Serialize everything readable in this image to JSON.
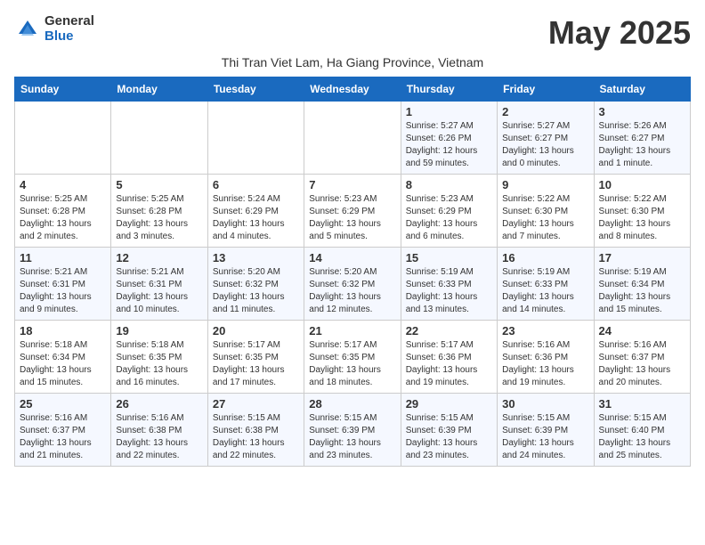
{
  "logo": {
    "general": "General",
    "blue": "Blue"
  },
  "header": {
    "month_title": "May 2025",
    "subtitle": "Thi Tran Viet Lam, Ha Giang Province, Vietnam"
  },
  "weekdays": [
    "Sunday",
    "Monday",
    "Tuesday",
    "Wednesday",
    "Thursday",
    "Friday",
    "Saturday"
  ],
  "weeks": [
    [
      {
        "day": "",
        "info": ""
      },
      {
        "day": "",
        "info": ""
      },
      {
        "day": "",
        "info": ""
      },
      {
        "day": "",
        "info": ""
      },
      {
        "day": "1",
        "info": "Sunrise: 5:27 AM\nSunset: 6:26 PM\nDaylight: 12 hours\nand 59 minutes."
      },
      {
        "day": "2",
        "info": "Sunrise: 5:27 AM\nSunset: 6:27 PM\nDaylight: 13 hours\nand 0 minutes."
      },
      {
        "day": "3",
        "info": "Sunrise: 5:26 AM\nSunset: 6:27 PM\nDaylight: 13 hours\nand 1 minute."
      }
    ],
    [
      {
        "day": "4",
        "info": "Sunrise: 5:25 AM\nSunset: 6:28 PM\nDaylight: 13 hours\nand 2 minutes."
      },
      {
        "day": "5",
        "info": "Sunrise: 5:25 AM\nSunset: 6:28 PM\nDaylight: 13 hours\nand 3 minutes."
      },
      {
        "day": "6",
        "info": "Sunrise: 5:24 AM\nSunset: 6:29 PM\nDaylight: 13 hours\nand 4 minutes."
      },
      {
        "day": "7",
        "info": "Sunrise: 5:23 AM\nSunset: 6:29 PM\nDaylight: 13 hours\nand 5 minutes."
      },
      {
        "day": "8",
        "info": "Sunrise: 5:23 AM\nSunset: 6:29 PM\nDaylight: 13 hours\nand 6 minutes."
      },
      {
        "day": "9",
        "info": "Sunrise: 5:22 AM\nSunset: 6:30 PM\nDaylight: 13 hours\nand 7 minutes."
      },
      {
        "day": "10",
        "info": "Sunrise: 5:22 AM\nSunset: 6:30 PM\nDaylight: 13 hours\nand 8 minutes."
      }
    ],
    [
      {
        "day": "11",
        "info": "Sunrise: 5:21 AM\nSunset: 6:31 PM\nDaylight: 13 hours\nand 9 minutes."
      },
      {
        "day": "12",
        "info": "Sunrise: 5:21 AM\nSunset: 6:31 PM\nDaylight: 13 hours\nand 10 minutes."
      },
      {
        "day": "13",
        "info": "Sunrise: 5:20 AM\nSunset: 6:32 PM\nDaylight: 13 hours\nand 11 minutes."
      },
      {
        "day": "14",
        "info": "Sunrise: 5:20 AM\nSunset: 6:32 PM\nDaylight: 13 hours\nand 12 minutes."
      },
      {
        "day": "15",
        "info": "Sunrise: 5:19 AM\nSunset: 6:33 PM\nDaylight: 13 hours\nand 13 minutes."
      },
      {
        "day": "16",
        "info": "Sunrise: 5:19 AM\nSunset: 6:33 PM\nDaylight: 13 hours\nand 14 minutes."
      },
      {
        "day": "17",
        "info": "Sunrise: 5:19 AM\nSunset: 6:34 PM\nDaylight: 13 hours\nand 15 minutes."
      }
    ],
    [
      {
        "day": "18",
        "info": "Sunrise: 5:18 AM\nSunset: 6:34 PM\nDaylight: 13 hours\nand 15 minutes."
      },
      {
        "day": "19",
        "info": "Sunrise: 5:18 AM\nSunset: 6:35 PM\nDaylight: 13 hours\nand 16 minutes."
      },
      {
        "day": "20",
        "info": "Sunrise: 5:17 AM\nSunset: 6:35 PM\nDaylight: 13 hours\nand 17 minutes."
      },
      {
        "day": "21",
        "info": "Sunrise: 5:17 AM\nSunset: 6:35 PM\nDaylight: 13 hours\nand 18 minutes."
      },
      {
        "day": "22",
        "info": "Sunrise: 5:17 AM\nSunset: 6:36 PM\nDaylight: 13 hours\nand 19 minutes."
      },
      {
        "day": "23",
        "info": "Sunrise: 5:16 AM\nSunset: 6:36 PM\nDaylight: 13 hours\nand 19 minutes."
      },
      {
        "day": "24",
        "info": "Sunrise: 5:16 AM\nSunset: 6:37 PM\nDaylight: 13 hours\nand 20 minutes."
      }
    ],
    [
      {
        "day": "25",
        "info": "Sunrise: 5:16 AM\nSunset: 6:37 PM\nDaylight: 13 hours\nand 21 minutes."
      },
      {
        "day": "26",
        "info": "Sunrise: 5:16 AM\nSunset: 6:38 PM\nDaylight: 13 hours\nand 22 minutes."
      },
      {
        "day": "27",
        "info": "Sunrise: 5:15 AM\nSunset: 6:38 PM\nDaylight: 13 hours\nand 22 minutes."
      },
      {
        "day": "28",
        "info": "Sunrise: 5:15 AM\nSunset: 6:39 PM\nDaylight: 13 hours\nand 23 minutes."
      },
      {
        "day": "29",
        "info": "Sunrise: 5:15 AM\nSunset: 6:39 PM\nDaylight: 13 hours\nand 23 minutes."
      },
      {
        "day": "30",
        "info": "Sunrise: 5:15 AM\nSunset: 6:39 PM\nDaylight: 13 hours\nand 24 minutes."
      },
      {
        "day": "31",
        "info": "Sunrise: 5:15 AM\nSunset: 6:40 PM\nDaylight: 13 hours\nand 25 minutes."
      }
    ]
  ]
}
